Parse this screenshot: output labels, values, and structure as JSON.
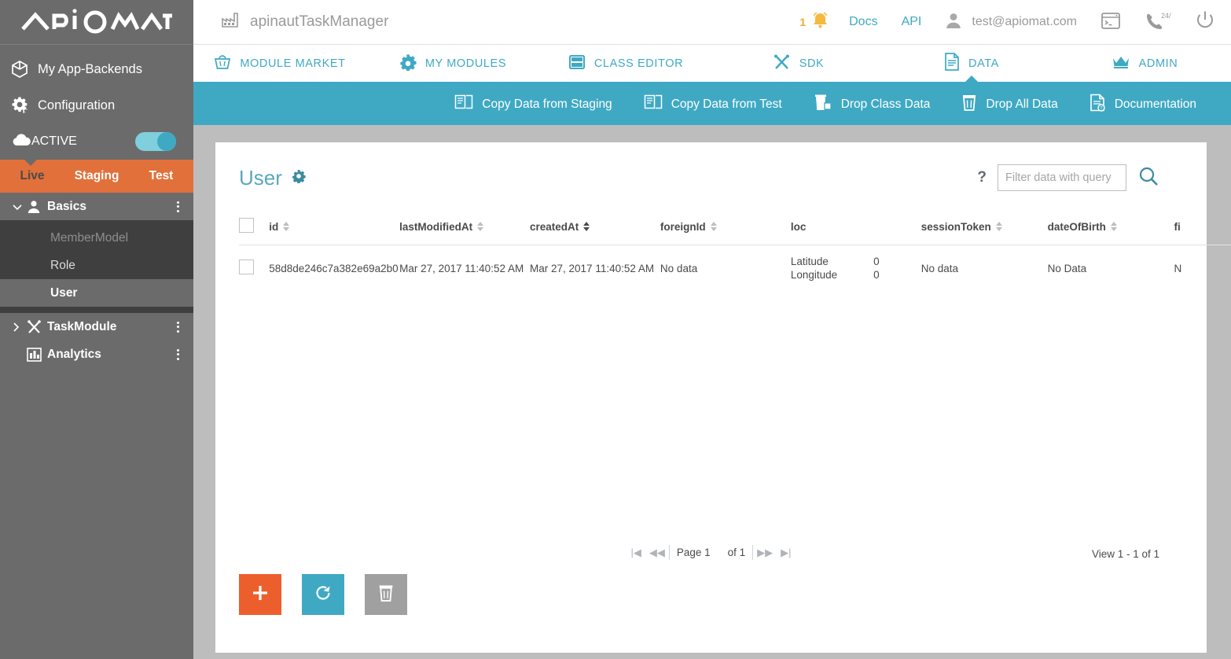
{
  "sidebar": {
    "logo_text": "APIOMAT",
    "nav": [
      {
        "label": "My App-Backends",
        "icon": "cube-icon"
      },
      {
        "label": "Configuration",
        "icon": "gear-icon"
      },
      {
        "label": "ACTIVE",
        "icon": "cloud-icon",
        "toggle": true
      }
    ],
    "env_tabs": [
      {
        "label": "Live",
        "selected": true
      },
      {
        "label": "Staging",
        "selected": false
      },
      {
        "label": "Test",
        "selected": false
      }
    ],
    "tree": {
      "basics": {
        "label": "Basics",
        "icon": "person-icon",
        "expanded": true,
        "children": [
          {
            "label": "MemberModel",
            "state": "dim"
          },
          {
            "label": "Role",
            "state": "normal"
          },
          {
            "label": "User",
            "state": "selected"
          }
        ]
      },
      "taskmodule": {
        "label": "TaskModule",
        "icon": "tools-icon",
        "expanded": false
      },
      "analytics": {
        "label": "Analytics",
        "icon": "chart-icon"
      }
    }
  },
  "topbar": {
    "app_name": "apinautTaskManager",
    "app_icon": "factory-icon",
    "notification_count": "1",
    "bell_icon": "bell-icon",
    "docs_label": "Docs",
    "api_label": "API",
    "user_email": "test@apiomat.com",
    "user_icon": "person-icon",
    "console_icon": "terminal-icon",
    "support_icon": "phone-247-icon",
    "power_icon": "power-icon"
  },
  "main_tabs": [
    {
      "label": "MODULE MARKET",
      "icon": "basket-icon",
      "active": false
    },
    {
      "label": "MY MODULES",
      "icon": "gear-icon",
      "active": false
    },
    {
      "label": "CLASS EDITOR",
      "icon": "class-icon",
      "active": false
    },
    {
      "label": "SDK",
      "icon": "tools-icon",
      "active": false
    },
    {
      "label": "DATA",
      "icon": "document-icon",
      "active": true
    },
    {
      "label": "ADMIN",
      "icon": "crown-icon",
      "active": false
    }
  ],
  "toolbar": [
    {
      "label": "Copy Data from Staging",
      "icon": "copy-data-icon"
    },
    {
      "label": "Copy Data from Test",
      "icon": "copy-data-icon"
    },
    {
      "label": "Drop Class Data",
      "icon": "trash-class-icon"
    },
    {
      "label": "Drop All Data",
      "icon": "trash-icon"
    },
    {
      "label": "Documentation",
      "icon": "doc-help-icon"
    }
  ],
  "card": {
    "title": "User",
    "title_gear_icon": "gear-icon",
    "help_label": "?",
    "filter_placeholder": "Filter data with query",
    "filter_value": "",
    "search_icon": "search-icon"
  },
  "table": {
    "columns": [
      {
        "label": "id",
        "sortable": true,
        "sort_active": false
      },
      {
        "label": "lastModifiedAt",
        "sortable": true,
        "sort_active": false
      },
      {
        "label": "createdAt",
        "sortable": true,
        "sort_active": true
      },
      {
        "label": "foreignId",
        "sortable": true,
        "sort_active": false
      },
      {
        "label": "loc",
        "sortable": false,
        "sort_active": false
      },
      {
        "label": "sessionToken",
        "sortable": true,
        "sort_active": false
      },
      {
        "label": "dateOfBirth",
        "sortable": true,
        "sort_active": false
      },
      {
        "label": "fi",
        "sortable": false,
        "sort_active": false
      }
    ],
    "rows": [
      {
        "id": "58d8de246c7a382e69a2b0",
        "lastModifiedAt": "Mar 27, 2017 11:40:52 AM",
        "createdAt": "Mar 27, 2017 11:40:52 AM",
        "foreignId": "No data",
        "loc_lat_label": "Latitude",
        "loc_lat_value": "0",
        "loc_lon_label": "Longitude",
        "loc_lon_value": "0",
        "sessionToken": "No data",
        "dateOfBirth": "No Data",
        "fi": "N"
      }
    ]
  },
  "pagination": {
    "first_icon": "first-page-icon",
    "prev_icon": "prev-page-icon",
    "page_label": "Page 1",
    "of_label": "of 1",
    "next_icon": "next-page-icon",
    "last_icon": "last-page-icon",
    "view_count": "View 1 - 1 of 1"
  },
  "actions": [
    {
      "name": "add",
      "icon": "plus-icon",
      "color": "#ec5f2d"
    },
    {
      "name": "refresh",
      "icon": "refresh-icon",
      "color": "#3fa9c4"
    },
    {
      "name": "delete",
      "icon": "trash-icon",
      "color": "#a0a0a0"
    }
  ]
}
